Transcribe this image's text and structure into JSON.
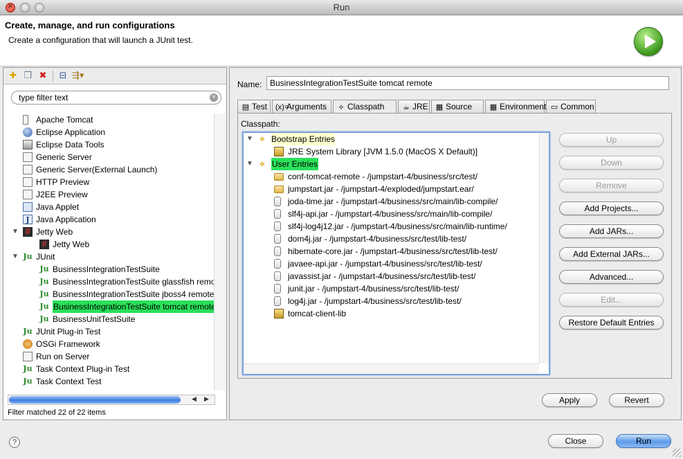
{
  "window": {
    "title": "Run"
  },
  "header": {
    "title": "Create, manage, and run configurations",
    "subtitle": "Create a configuration that will launch a JUnit test."
  },
  "left_toolbar": {
    "icons": [
      "new-config-icon",
      "duplicate-icon",
      "delete-icon",
      "collapse-all-icon",
      "filter-menu-icon"
    ]
  },
  "filter": {
    "placeholder": "type filter text",
    "value": "type filter text"
  },
  "tree": [
    {
      "label": "Apache Tomcat",
      "icon": "tomcat-icon",
      "level": 1
    },
    {
      "label": "Eclipse Application",
      "icon": "eclipse-app-icon",
      "level": 1
    },
    {
      "label": "Eclipse Data Tools",
      "icon": "data-tools-icon",
      "level": 1
    },
    {
      "label": "Generic Server",
      "icon": "server-icon",
      "level": 1
    },
    {
      "label": "Generic Server(External Launch)",
      "icon": "server-icon",
      "level": 1
    },
    {
      "label": "HTTP Preview",
      "icon": "server-icon",
      "level": 1
    },
    {
      "label": "J2EE Preview",
      "icon": "server-icon",
      "level": 1
    },
    {
      "label": "Java Applet",
      "icon": "java-applet-icon",
      "level": 1
    },
    {
      "label": "Java Application",
      "icon": "java-app-icon",
      "level": 1
    },
    {
      "label": "Jetty Web",
      "icon": "jetty-icon",
      "level": 1,
      "expanded": true
    },
    {
      "label": "Jetty Web",
      "icon": "jetty-icon",
      "level": 2
    },
    {
      "label": "JUnit",
      "icon": "junit-icon",
      "level": 1,
      "expanded": true
    },
    {
      "label": "BusinessIntegrationTestSuite",
      "icon": "junit-icon",
      "level": 2
    },
    {
      "label": "BusinessIntegrationTestSuite glassfish remote",
      "icon": "junit-icon",
      "level": 2
    },
    {
      "label": "BusinessIntegrationTestSuite jboss4 remote",
      "icon": "junit-icon",
      "level": 2
    },
    {
      "label": "BusinessIntegrationTestSuite tomcat remote",
      "icon": "junit-icon",
      "level": 2,
      "selected": true
    },
    {
      "label": "BusinessUnitTestSuite",
      "icon": "junit-icon",
      "level": 2
    },
    {
      "label": "JUnit Plug-in Test",
      "icon": "junit-plugin-icon",
      "level": 1
    },
    {
      "label": "OSGi Framework",
      "icon": "osgi-icon",
      "level": 1
    },
    {
      "label": "Run on Server",
      "icon": "run-server-icon",
      "level": 1
    },
    {
      "label": "Task Context Plug-in Test",
      "icon": "junit-plugin-icon",
      "level": 1
    },
    {
      "label": "Task Context Test",
      "icon": "junit-plugin-icon",
      "level": 1
    }
  ],
  "filter_status": "Filter matched 22 of 22 items",
  "name_label": "Name:",
  "name_value": "BusinessIntegrationTestSuite tomcat remote",
  "tabs": [
    {
      "label": "Test",
      "icon": "test-tab-icon"
    },
    {
      "label": "Arguments",
      "icon": "arguments-tab-icon"
    },
    {
      "label": "Classpath",
      "icon": "classpath-tab-icon",
      "active": true
    },
    {
      "label": "JRE",
      "icon": "jre-tab-icon"
    },
    {
      "label": "Source",
      "icon": "source-tab-icon"
    },
    {
      "label": "Environment",
      "icon": "environment-tab-icon"
    },
    {
      "label": "Common",
      "icon": "common-tab-icon"
    }
  ],
  "classpath": {
    "label": "Classpath:",
    "bootstrap": {
      "label": "Bootstrap Entries",
      "children": [
        "JRE System Library [JVM 1.5.0 (MacOS X Default)]"
      ]
    },
    "user": {
      "label": "User Entries",
      "children": [
        {
          "label": "conf-tomcat-remote - /jumpstart-4/business/src/test/",
          "icon": "folder-icon"
        },
        {
          "label": "jumpstart.jar - /jumpstart-4/exploded/jumpstart.ear/",
          "icon": "folder-icon"
        },
        {
          "label": "joda-time.jar - /jumpstart-4/business/src/main/lib-compile/",
          "icon": "jar-icon"
        },
        {
          "label": "slf4j-api.jar - /jumpstart-4/business/src/main/lib-compile/",
          "icon": "jar-icon"
        },
        {
          "label": "slf4j-log4j12.jar - /jumpstart-4/business/src/main/lib-runtime/",
          "icon": "jar-icon"
        },
        {
          "label": "dom4j.jar - /jumpstart-4/business/src/test/lib-test/",
          "icon": "jar-icon"
        },
        {
          "label": "hibernate-core.jar - /jumpstart-4/business/src/test/lib-test/",
          "icon": "jar-icon"
        },
        {
          "label": "javaee-api.jar - /jumpstart-4/business/src/test/lib-test/",
          "icon": "jar-icon"
        },
        {
          "label": "javassist.jar - /jumpstart-4/business/src/test/lib-test/",
          "icon": "jar-icon"
        },
        {
          "label": "junit.jar - /jumpstart-4/business/src/test/lib-test/",
          "icon": "jar-icon"
        },
        {
          "label": "log4j.jar - /jumpstart-4/business/src/test/lib-test/",
          "icon": "jar-icon"
        },
        {
          "label": "tomcat-client-lib",
          "icon": "library-icon"
        }
      ]
    }
  },
  "side_buttons": [
    {
      "label": "Up",
      "enabled": false
    },
    {
      "label": "Down",
      "enabled": false
    },
    {
      "label": "Remove",
      "enabled": false
    },
    {
      "label": "Add Projects...",
      "enabled": true
    },
    {
      "label": "Add JARs...",
      "enabled": true
    },
    {
      "label": "Add External JARs...",
      "enabled": true
    },
    {
      "label": "Advanced...",
      "enabled": true
    },
    {
      "label": "Edit...",
      "enabled": false
    },
    {
      "label": "Restore Default Entries",
      "enabled": true
    }
  ],
  "apply_label": "Apply",
  "revert_label": "Revert",
  "close_label": "Close",
  "run_label": "Run",
  "help_symbol": "?",
  "colors": {
    "selection": "#2ae05a",
    "default_button": "#5c9ae8"
  }
}
